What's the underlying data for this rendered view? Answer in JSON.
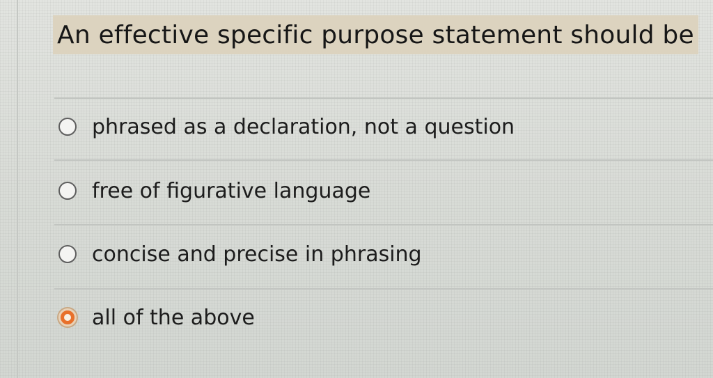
{
  "question": {
    "text": "An effective specific purpose statement should be"
  },
  "options": [
    {
      "label": "phrased as a declaration, not a question",
      "selected": false
    },
    {
      "label": "free of figurative language",
      "selected": false
    },
    {
      "label": "concise and precise in phrasing",
      "selected": false
    },
    {
      "label": "all of the above",
      "selected": true
    }
  ],
  "colors": {
    "selected_radio": "#e8702a",
    "question_highlight": "#dcd3bf"
  }
}
